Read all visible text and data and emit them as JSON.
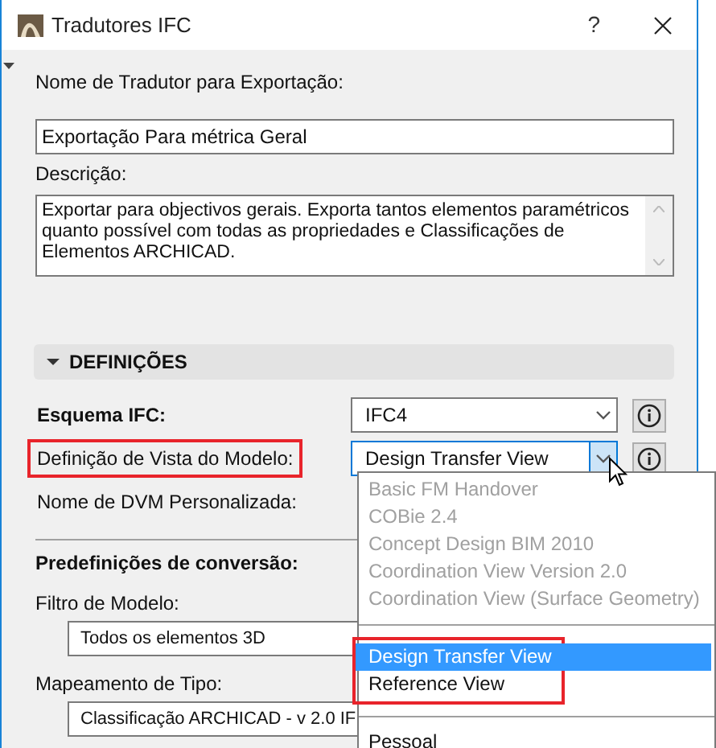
{
  "window": {
    "title": "Tradutores IFC",
    "help": "?"
  },
  "name_field": {
    "label": "Nome de Tradutor para Exportação:",
    "value": "Exportação Para métrica Geral"
  },
  "description": {
    "label": "Descrição:",
    "value": "Exportar para objectivos gerais. Exporta tantos elementos paramétricos quanto possível com todas as propriedades e Classificações de Elementos ARCHICAD."
  },
  "section": {
    "title": "DEFINIÇÕES",
    "expanded": true
  },
  "settings": [
    {
      "label": "Esquema IFC:",
      "bold": true,
      "highlighted": false,
      "value": "IFC4",
      "open": false
    },
    {
      "label": "Definição de Vista do Modelo:",
      "bold": false,
      "highlighted": true,
      "value": "Design Transfer View",
      "open": true
    },
    {
      "label": "Nome de DVM Personalizada:",
      "bold": false,
      "highlighted": false
    }
  ],
  "presets": {
    "title": "Predefinições de conversão:",
    "fields": [
      {
        "label": "Filtro de Modelo:",
        "value": "Todos os elementos 3D"
      },
      {
        "label": "Mapeamento de Tipo:",
        "value": "Classificação ARCHICAD - v 2.0 IF"
      }
    ]
  },
  "dropdown": {
    "groups": [
      {
        "highlighted": false,
        "options": [
          {
            "label": "Basic FM Handover",
            "disabled": true,
            "selected": false
          },
          {
            "label": "COBie 2.4",
            "disabled": true,
            "selected": false
          },
          {
            "label": "Concept Design BIM 2010",
            "disabled": true,
            "selected": false
          },
          {
            "label": "Coordination View Version 2.0",
            "disabled": true,
            "selected": false
          },
          {
            "label": "Coordination View (Surface Geometry)",
            "disabled": true,
            "selected": false
          }
        ]
      },
      {
        "highlighted": true,
        "options": [
          {
            "label": "Design Transfer View",
            "disabled": false,
            "selected": true
          },
          {
            "label": "Reference View",
            "disabled": false,
            "selected": false
          }
        ]
      },
      {
        "highlighted": false,
        "options": [
          {
            "label": "Pessoal",
            "disabled": false,
            "selected": false
          }
        ]
      }
    ]
  }
}
